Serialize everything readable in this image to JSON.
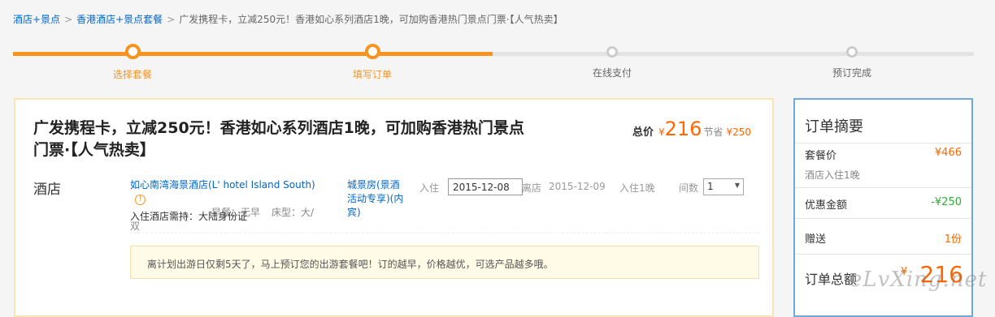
{
  "breadcrumb": {
    "items": [
      "酒店+景点",
      "香港酒店+景点套餐"
    ],
    "current": "广发携程卡，立减250元！香港如心系列酒店1晚，可加购香港热门景点门票·【人气热卖】"
  },
  "steps": [
    {
      "label": "选择套餐",
      "state": "done"
    },
    {
      "label": "填写订单",
      "state": "done"
    },
    {
      "label": "在线支付",
      "state": "todo"
    },
    {
      "label": "预订完成",
      "state": "todo"
    }
  ],
  "product": {
    "title": "广发携程卡，立减250元！香港如心系列酒店1晚，可加购香港热门景点门票·【人气热卖】",
    "total_label": "总价",
    "currency": "¥",
    "total_price": "216",
    "save_label": "节省",
    "save_amount": "¥250"
  },
  "hotel": {
    "section_label": "酒店",
    "name": "如心南湾海景酒店(L' hotel Island South)",
    "room": "城景房(景酒活动专享)(内宾)",
    "breakfast": "早餐：无早",
    "bed": "床型：大/双",
    "checkin_label": "入住",
    "checkin_date": "2015-12-08",
    "checkout_label": "离店",
    "checkout_date": "2015-12-09",
    "nights": "入住1晚",
    "rooms_label": "间数",
    "rooms_value": "1",
    "requirement": "入住酒店需持：大陆身份证"
  },
  "notice": "离计划出游日仅剩5天了，马上预订您的出游套餐吧！订的越早，价格越优，可选产品越多哦。",
  "summary": {
    "title": "订单摘要",
    "package_label": "套餐价",
    "package_value": "¥466",
    "package_sub": "酒店入住1晚",
    "discount_label": "优惠金额",
    "discount_value": "-¥250",
    "gift_label": "赠送",
    "gift_value": "1份",
    "total_label": "订单总额",
    "total_currency": "¥",
    "total_value": "216"
  },
  "watermark": "eLvXing.net",
  "colors": {
    "accent": "#f7931e",
    "price": "#ff6600",
    "link": "#0066cc",
    "summary_border": "#6fa8dc"
  }
}
